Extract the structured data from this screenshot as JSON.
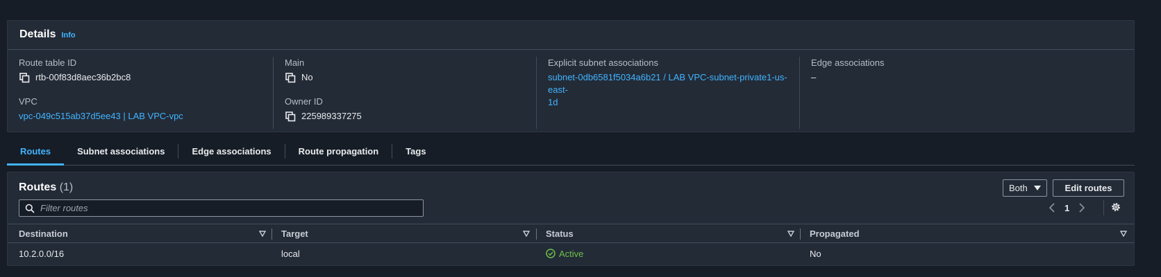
{
  "details": {
    "title": "Details",
    "info_label": "Info",
    "route_table_id": {
      "label": "Route table ID",
      "value": "rtb-00f83d8aec36b2bc8"
    },
    "vpc": {
      "label": "VPC",
      "value": "vpc-049c515ab37d5ee43 | LAB VPC-vpc"
    },
    "main": {
      "label": "Main",
      "value": "No"
    },
    "owner_id": {
      "label": "Owner ID",
      "value": "225989337275"
    },
    "explicit_subnet_associations": {
      "label": "Explicit subnet associations",
      "value_line1": "subnet-0db6581f5034a6b21 / LAB VPC-subnet-private1-us-east-",
      "value_line2": "1d"
    },
    "edge_associations": {
      "label": "Edge associations",
      "value": "–"
    }
  },
  "tabs": [
    {
      "label": "Routes",
      "active": true
    },
    {
      "label": "Subnet associations",
      "active": false
    },
    {
      "label": "Edge associations",
      "active": false
    },
    {
      "label": "Route propagation",
      "active": false
    },
    {
      "label": "Tags",
      "active": false
    }
  ],
  "routes": {
    "title": "Routes",
    "count": "(1)",
    "filter_select_value": "Both",
    "edit_button_label": "Edit routes",
    "filter_placeholder": "Filter routes",
    "current_page": "1",
    "columns": [
      "Destination",
      "Target",
      "Status",
      "Propagated"
    ],
    "rows": [
      {
        "destination": "10.2.0.0/16",
        "target": "local",
        "status": "Active",
        "propagated": "No"
      }
    ]
  },
  "colors": {
    "background": "#161d26",
    "panel": "#232b37",
    "link": "#42b4ff",
    "status_active": "#6fc04a"
  },
  "icons": [
    "copy-icon",
    "caret-down-icon",
    "search-icon",
    "chevron-left-icon",
    "chevron-right-icon",
    "gear-icon",
    "check-circle-icon"
  ]
}
